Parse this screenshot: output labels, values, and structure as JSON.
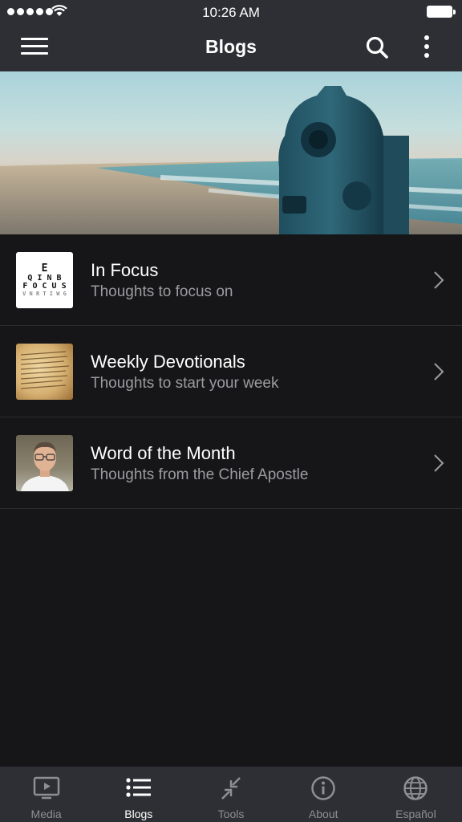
{
  "status": {
    "time": "10:26 AM"
  },
  "header": {
    "title": "Blogs"
  },
  "blogs": [
    {
      "title": "In Focus",
      "subtitle": "Thoughts to focus on",
      "thumb": "eye-chart-focus"
    },
    {
      "title": "Weekly Devotionals",
      "subtitle": "Thoughts to start your week",
      "thumb": "bible-page"
    },
    {
      "title": "Word of the Month",
      "subtitle": "Thoughts from the Chief Apostle",
      "thumb": "chief-apostle-portrait"
    }
  ],
  "focus_chart": {
    "row1": "E",
    "row2": "Q I N B",
    "row3": "F O C U S",
    "row4": "V N R T I W G"
  },
  "tabs": [
    {
      "label": "Media",
      "icon": "play-screen-icon",
      "active": false
    },
    {
      "label": "Blogs",
      "icon": "list-icon",
      "active": true
    },
    {
      "label": "Tools",
      "icon": "compress-arrows-icon",
      "active": false
    },
    {
      "label": "About",
      "icon": "info-icon",
      "active": false
    },
    {
      "label": "Español",
      "icon": "globe-icon",
      "active": false
    }
  ],
  "colors": {
    "bar": "#2d2f34",
    "background": "#161618",
    "inactive": "#8e8e93",
    "active": "#ffffff"
  }
}
